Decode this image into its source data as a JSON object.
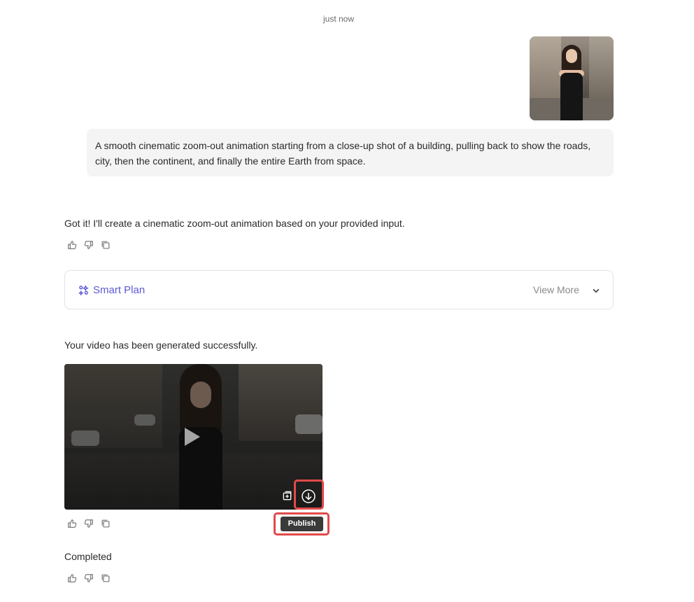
{
  "conversation": {
    "timestamp": "just now",
    "user_prompt": "A smooth cinematic zoom-out animation starting from a close-up shot of a building, pulling back to show the roads, city, then the continent, and finally the entire Earth from space.",
    "assistant_reply": "Got it! I'll create a cinematic zoom-out animation based on your provided input.",
    "smart_plan": {
      "label": "Smart Plan",
      "view_more": "View More"
    },
    "video_status": "Your video has been generated successfully.",
    "video": {
      "tooltip": "Publish"
    },
    "completed": "Completed"
  },
  "icons": {
    "like": "thumbs-up-icon",
    "dislike": "thumbs-down-icon",
    "copy": "copy-icon",
    "smart_plan": "sparkle-icon",
    "chevron": "chevron-down-icon",
    "play": "play-icon",
    "add": "add-to-canvas-icon",
    "download": "download-icon"
  },
  "colors": {
    "accent": "#5b5bd6",
    "highlight": "#e14a4a",
    "bubble_bg": "#f4f4f4",
    "tooltip_bg": "#3a3a3a"
  }
}
